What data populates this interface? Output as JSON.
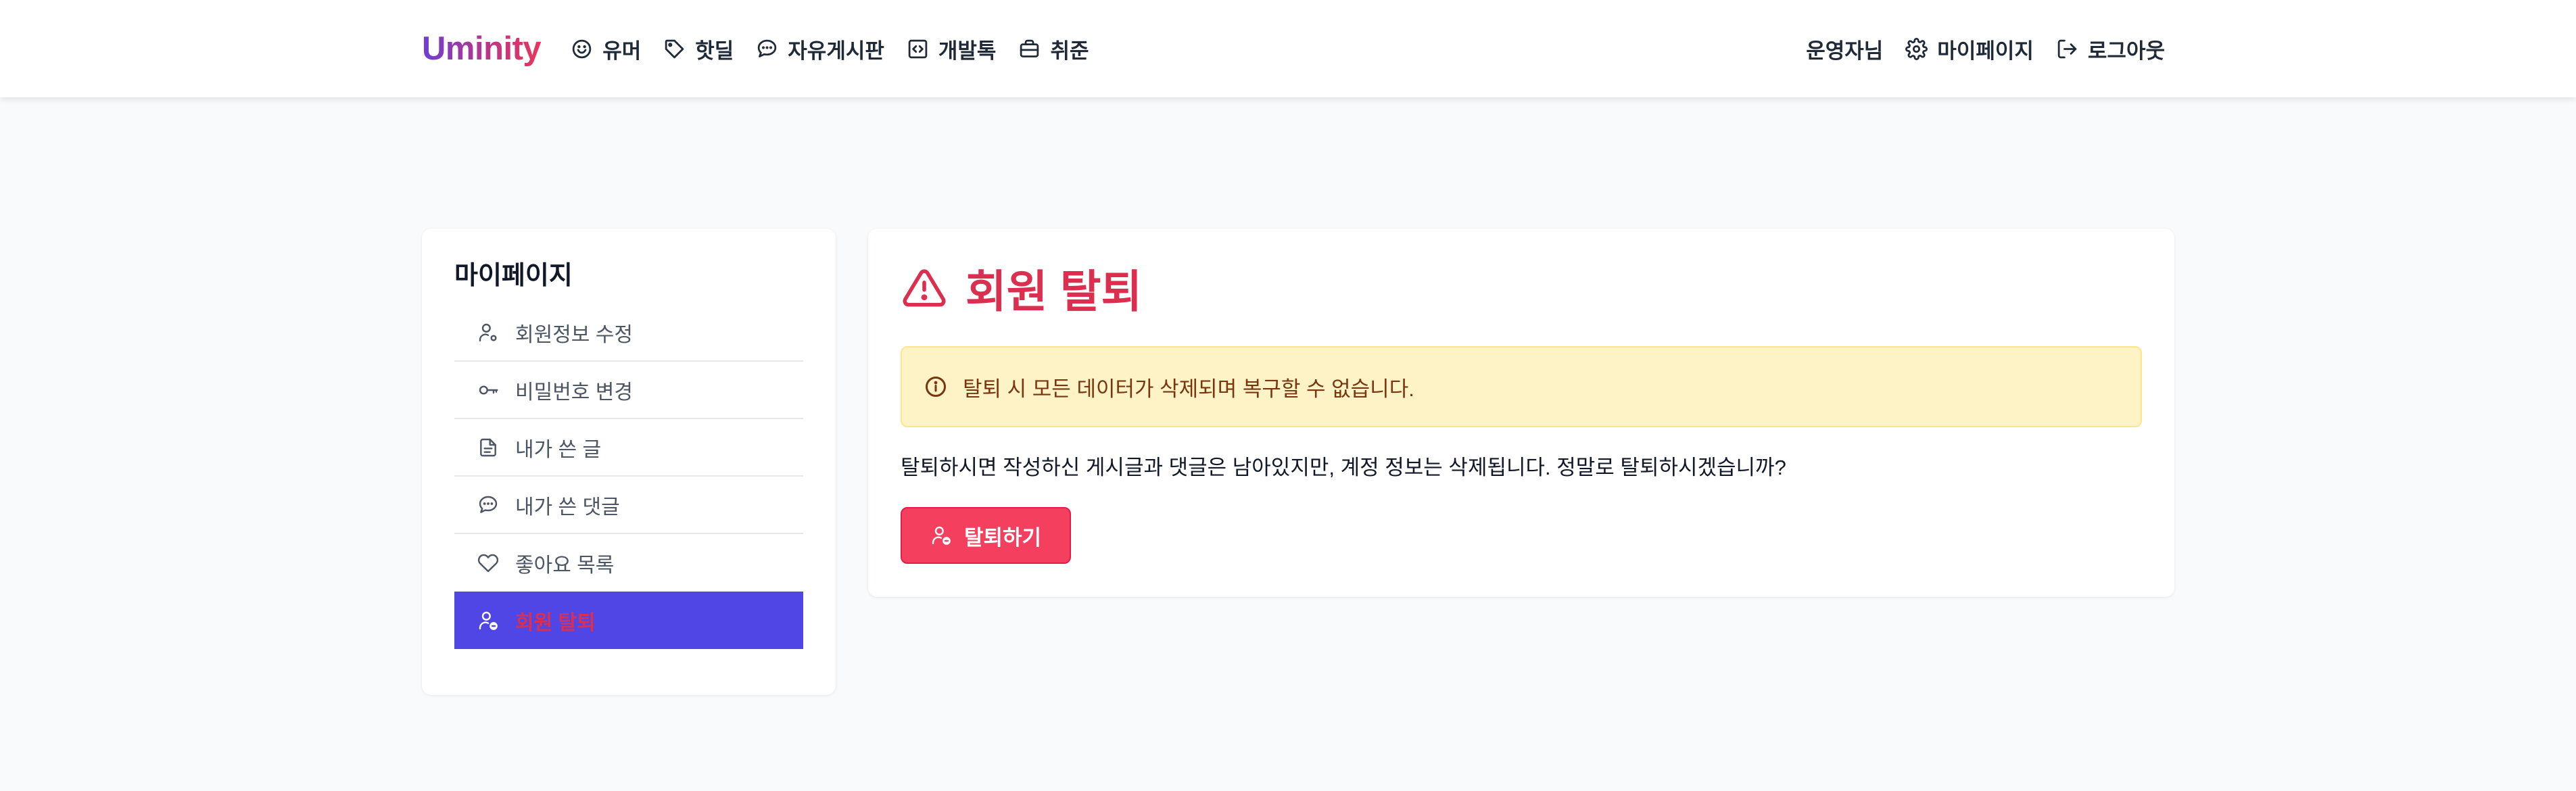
{
  "header": {
    "logo": "Uminity",
    "nav": [
      {
        "label": "유머",
        "icon": "smile-icon"
      },
      {
        "label": "핫딜",
        "icon": "tag-icon"
      },
      {
        "label": "자유게시판",
        "icon": "chat-bubble-icon"
      },
      {
        "label": "개발톡",
        "icon": "code-icon"
      },
      {
        "label": "취준",
        "icon": "briefcase-icon"
      }
    ],
    "user_name": "운영자님",
    "mypage_label": "마이페이지",
    "logout_label": "로그아웃"
  },
  "sidebar": {
    "title": "마이페이지",
    "items": [
      {
        "label": "회원정보 수정",
        "icon": "user-settings-icon"
      },
      {
        "label": "비밀번호 변경",
        "icon": "key-icon"
      },
      {
        "label": "내가 쓴 글",
        "icon": "document-icon"
      },
      {
        "label": "내가 쓴 댓글",
        "icon": "chat-bubble-icon"
      },
      {
        "label": "좋아요 목록",
        "icon": "heart-icon"
      },
      {
        "label": "회원 탈퇴",
        "icon": "user-remove-icon",
        "active": true
      }
    ]
  },
  "main": {
    "title": "회원 탈퇴",
    "warning": "탈퇴 시 모든 데이터가 삭제되며 복구할 수 없습니다.",
    "description": "탈퇴하시면 작성하신 게시글과 댓글은 남아있지만, 계정 정보는 삭제됩니다. 정말로 탈퇴하시겠습니까?",
    "button_label": "탈퇴하기"
  },
  "colors": {
    "accent": "#4f46e5",
    "danger": "#dc2f4f",
    "button": "#f43f5e",
    "warning_bg": "#fef3c7"
  }
}
